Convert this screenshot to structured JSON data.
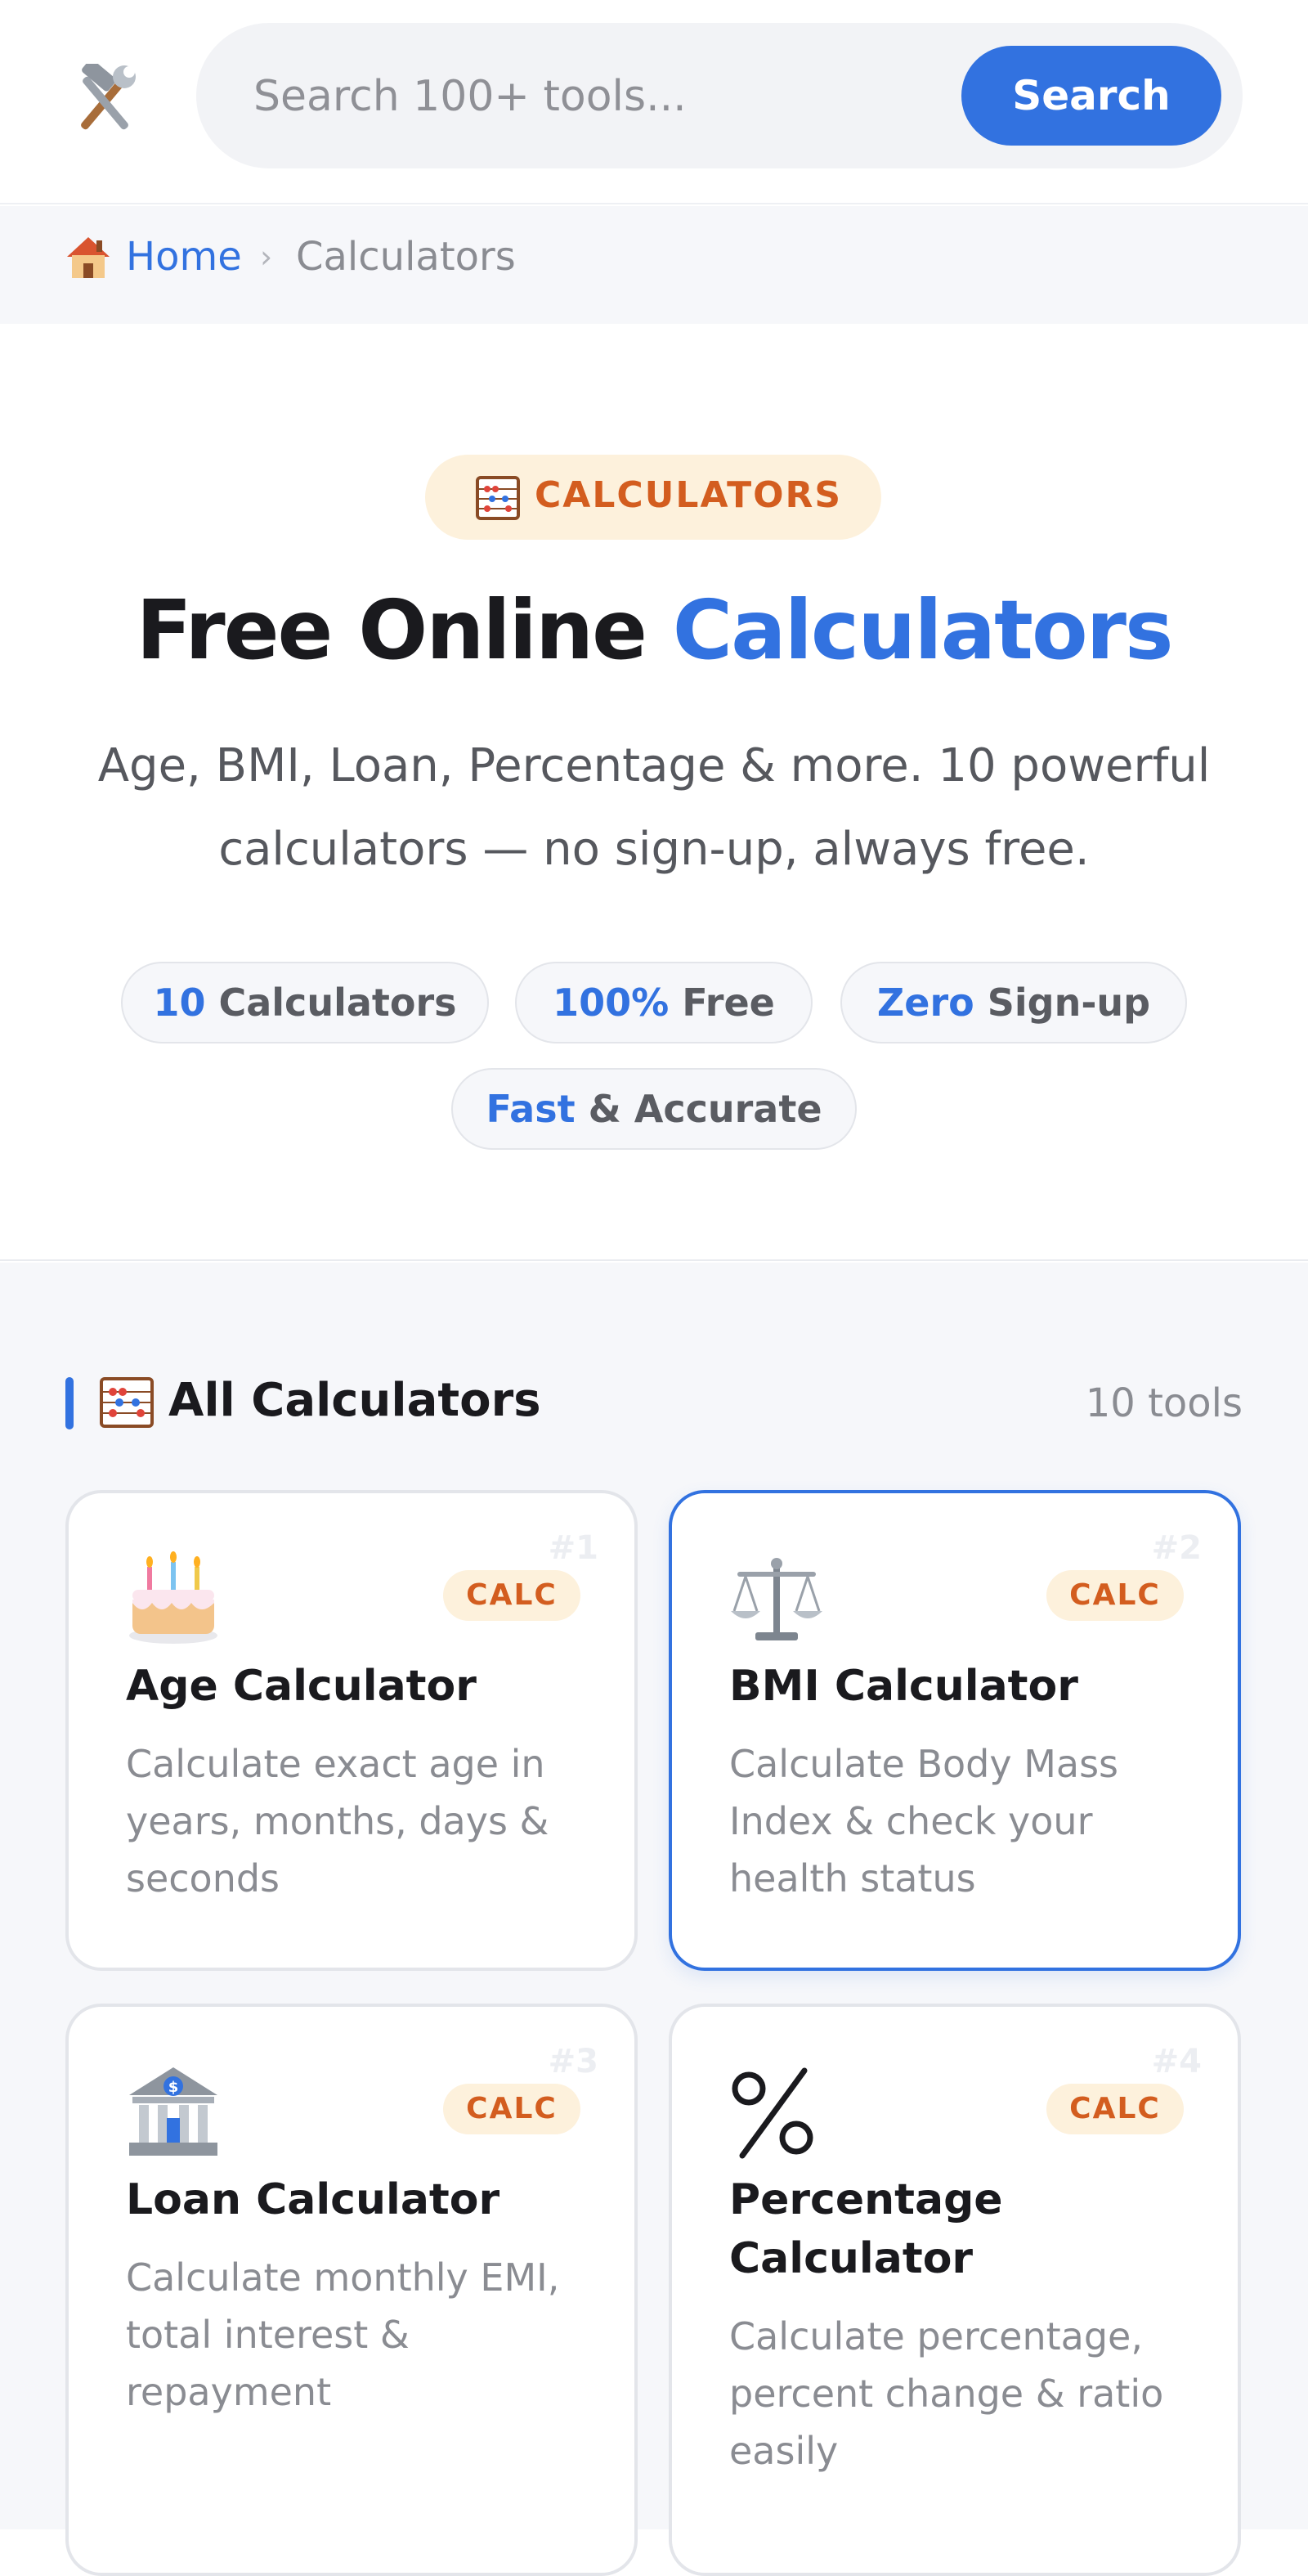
{
  "header": {
    "logo_icon": "hammer-and-wrench-icon",
    "search_placeholder": "Search 100+ tools...",
    "search_button": "Search"
  },
  "breadcrumb": {
    "home_icon": "house-icon",
    "home": "Home",
    "separator": "›",
    "current": "Calculators"
  },
  "hero": {
    "pill_icon": "abacus-icon",
    "pill_label": "CALCULATORS",
    "title_plain": "Free Online ",
    "title_accent": "Calculators",
    "subtitle_line1": "Age, BMI, Loan, Percentage & more. 10 powerful",
    "subtitle_line2": "calculators — no sign-up, always free.",
    "stats": [
      {
        "value": "10",
        "label": " Calculators"
      },
      {
        "value": "100%",
        "label": " Free"
      },
      {
        "value": "Zero",
        "label": " Sign-up"
      },
      {
        "value": "Fast",
        "label": " & Accurate"
      }
    ]
  },
  "section": {
    "icon": "abacus-icon",
    "title": "All Calculators",
    "count": "10 tools"
  },
  "cards": [
    {
      "num": "#1",
      "icon": "birthday-cake-icon",
      "tag": "CALC",
      "title": "Age Calculator",
      "desc": "Calculate exact age in years, months, days & seconds",
      "active": false
    },
    {
      "num": "#2",
      "icon": "balance-scale-icon",
      "tag": "CALC",
      "title": "BMI Calculator",
      "desc": "Calculate Body Mass Index & check your health status",
      "active": true
    },
    {
      "num": "#3",
      "icon": "bank-icon",
      "tag": "CALC",
      "title": "Loan Calculator",
      "desc": "Calculate monthly EMI, total interest & repayment",
      "active": false
    },
    {
      "num": "#4",
      "icon": "percent-icon",
      "tag": "CALC",
      "title": "Percentage Calculator",
      "desc": "Calculate percentage, percent change & ratio easily",
      "active": false
    }
  ],
  "colors": {
    "accent": "#3272e0",
    "tag_bg": "#fdf1dc",
    "tag_text": "#d35d1f"
  }
}
